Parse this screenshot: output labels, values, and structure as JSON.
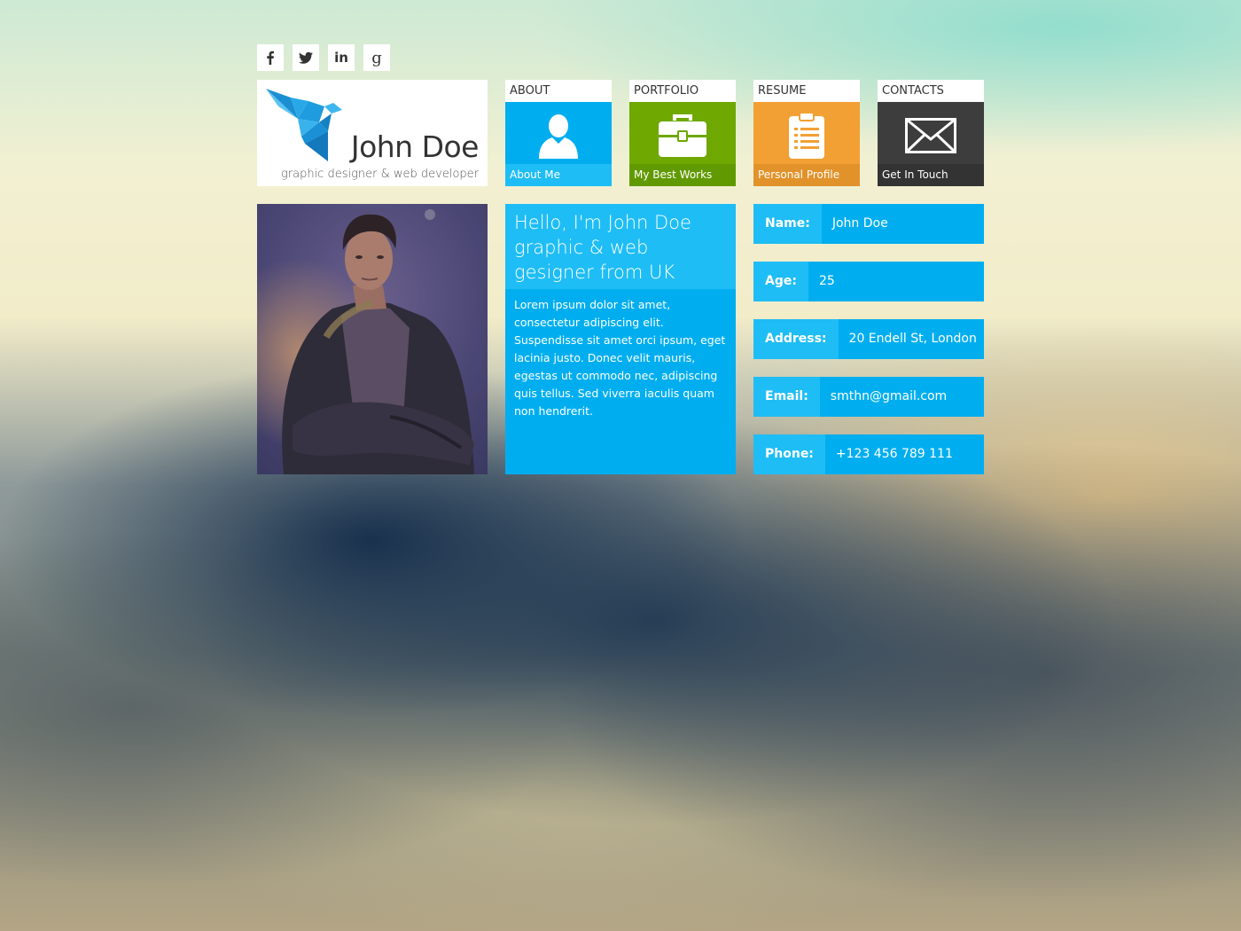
{
  "social": [
    {
      "name": "facebook",
      "icon": "facebook-icon"
    },
    {
      "name": "twitter",
      "icon": "twitter-icon"
    },
    {
      "name": "linkedin",
      "icon": "linkedin-icon",
      "glyph": "in"
    },
    {
      "name": "google",
      "icon": "google-icon",
      "glyph": "g"
    }
  ],
  "logo": {
    "name": "John Doe",
    "subtitle": "graphic designer & web developer",
    "icon": "origami-bird-icon"
  },
  "nav": [
    {
      "label": "ABOUT",
      "caption": "About Me",
      "icon": "user-icon",
      "color": "#00aeef",
      "caption_bg": "#1fbdf5"
    },
    {
      "label": "PORTFOLIO",
      "caption": "My Best Works",
      "icon": "briefcase-icon",
      "color": "#6ea800",
      "caption_bg": "#619a00"
    },
    {
      "label": "RESUME",
      "caption": "Personal Profile",
      "icon": "clipboard-icon",
      "color": "#f2a033",
      "caption_bg": "#e2922a"
    },
    {
      "label": "CONTACTS",
      "caption": "Get In Touch",
      "icon": "envelope-icon",
      "color": "#3d3d3d",
      "caption_bg": "#333333"
    }
  ],
  "intro": {
    "heading": "Hello, I'm John Doe graphic & web gesigner from UK",
    "body": "Lorem ipsum dolor sit amet, consectetur adipiscing elit. Suspendisse sit amet orci ipsum, eget lacinia justo. Donec velit mauris, egestas ut commodo nec, adipiscing quis tellus. Sed viverra iaculis quam non hendrerit."
  },
  "info": [
    {
      "key": "Name:",
      "value": "John Doe"
    },
    {
      "key": "Age:",
      "value": "25"
    },
    {
      "key": "Address:",
      "value": "20 Endell St, London"
    },
    {
      "key": "Email:",
      "value": "smthn@gmail.com"
    },
    {
      "key": "Phone:",
      "value": "+123 456 789 111"
    }
  ],
  "colors": {
    "accent": "#00aeef",
    "accent_light": "#1fbdf5"
  }
}
